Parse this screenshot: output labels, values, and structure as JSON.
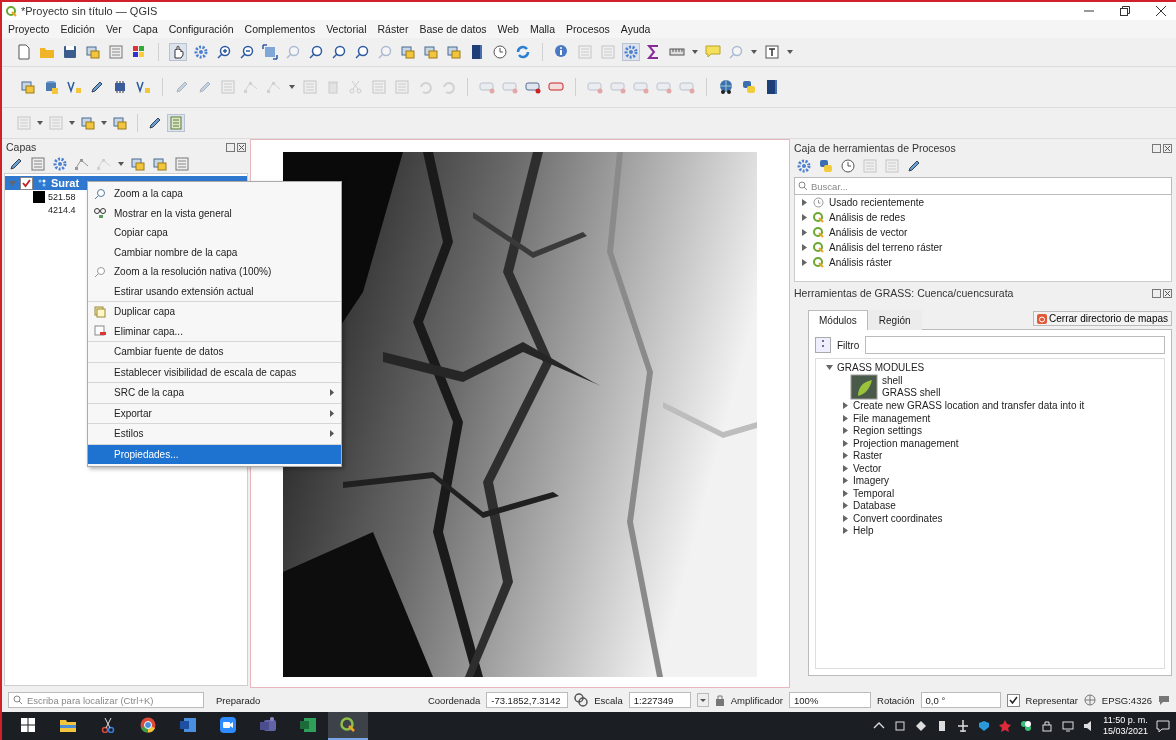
{
  "window": {
    "title": "*Proyecto sin título — QGIS"
  },
  "menu_bar": [
    "Proyecto",
    "Edición",
    "Ver",
    "Capa",
    "Configuración",
    "Complementos",
    "Vectorial",
    "Ráster",
    "Base de datos",
    "Web",
    "Malla",
    "Procesos",
    "Ayuda"
  ],
  "layers_panel": {
    "title": "Capas",
    "layers": [
      {
        "name": "Surat",
        "checked": true,
        "selected": true,
        "expanded": true,
        "legend": [
          "521.58",
          "4214.4"
        ]
      }
    ]
  },
  "context_menu": {
    "items": [
      {
        "label": "Zoom a la capa",
        "kind": "zoom",
        "submenu": false,
        "divider_above": false,
        "selected": false
      },
      {
        "label": "Mostrar en la vista general",
        "kind": "overview",
        "submenu": false,
        "divider_above": false,
        "selected": false
      },
      {
        "label": "Copiar capa",
        "kind": "plain",
        "submenu": false,
        "divider_above": false,
        "selected": false
      },
      {
        "label": "Cambiar nombre de la capa",
        "kind": "plain",
        "submenu": false,
        "divider_above": false,
        "selected": false
      },
      {
        "label": "Zoom a la resolución nativa (100%)",
        "kind": "native",
        "submenu": false,
        "divider_above": false,
        "selected": false
      },
      {
        "label": "Estirar usando extensión actual",
        "kind": "plain",
        "submenu": false,
        "divider_above": false,
        "selected": false
      },
      {
        "label": "Duplicar capa",
        "kind": "duplicate",
        "submenu": false,
        "divider_above": true,
        "selected": false
      },
      {
        "label": "Eliminar capa...",
        "kind": "remove",
        "submenu": false,
        "divider_above": false,
        "selected": false
      },
      {
        "label": "Cambiar fuente de datos",
        "kind": "plain",
        "submenu": false,
        "divider_above": true,
        "selected": false
      },
      {
        "label": "Establecer visibilidad de escala de capas",
        "kind": "plain",
        "submenu": false,
        "divider_above": true,
        "selected": false
      },
      {
        "label": "SRC de la capa",
        "kind": "plain",
        "submenu": true,
        "divider_above": true,
        "selected": false
      },
      {
        "label": "Exportar",
        "kind": "plain",
        "submenu": true,
        "divider_above": true,
        "selected": false
      },
      {
        "label": "Estilos",
        "kind": "plain",
        "submenu": true,
        "divider_above": true,
        "selected": false
      },
      {
        "label": "Propiedades...",
        "kind": "plain",
        "submenu": false,
        "divider_above": true,
        "selected": true
      }
    ]
  },
  "processing_toolbox": {
    "title": "Caja de herramientas de Procesos",
    "search": {
      "placeholder": "Buscar..."
    },
    "items": [
      {
        "label": "Usado recientemente",
        "kind": "recent",
        "expanded": false
      },
      {
        "label": "Análisis de redes",
        "kind": "provider",
        "expanded": false
      },
      {
        "label": "Análisis de vector",
        "kind": "provider",
        "expanded": false
      },
      {
        "label": "Análisis del terreno ráster",
        "kind": "provider",
        "expanded": false
      },
      {
        "label": "Análisis ráster",
        "kind": "provider",
        "expanded": false
      }
    ]
  },
  "grass_tools": {
    "title": "Herramientas de GRASS: Cuenca/cuencsurata",
    "tabs": [
      {
        "label": "Módulos",
        "selected": true
      },
      {
        "label": "Región",
        "selected": false
      }
    ],
    "close_button": "Cerrar directorio de mapas",
    "filter": {
      "label": "Filtro"
    },
    "tree": {
      "label": "GRASS MODULES",
      "expanded": true,
      "children": [
        {
          "kind": "module",
          "name": "shell",
          "description": "GRASS shell"
        },
        {
          "kind": "group",
          "label": "Create new GRASS location and transfer data into it",
          "expanded": false
        },
        {
          "kind": "group",
          "label": "File management",
          "expanded": false
        },
        {
          "kind": "group",
          "label": "Region settings",
          "expanded": false
        },
        {
          "kind": "group",
          "label": "Projection management",
          "expanded": false
        },
        {
          "kind": "group",
          "label": "Raster",
          "expanded": false
        },
        {
          "kind": "group",
          "label": "Vector",
          "expanded": false
        },
        {
          "kind": "group",
          "label": "Imagery",
          "expanded": false
        },
        {
          "kind": "group",
          "label": "Temporal",
          "expanded": false
        },
        {
          "kind": "group",
          "label": "Database",
          "expanded": false
        },
        {
          "kind": "group",
          "label": "Convert coordinates",
          "expanded": false
        },
        {
          "kind": "group",
          "label": "Help",
          "expanded": false
        }
      ]
    }
  },
  "status_bar": {
    "locator": {
      "placeholder": "Escriba para localizar (Ctrl+K)"
    },
    "message": "Preparado",
    "coordinate": {
      "label": "Coordenada",
      "value": "-73.1852,7.3142"
    },
    "scale": {
      "label": "Escala",
      "value": "1:227349"
    },
    "magnifier": {
      "label": "Amplificador",
      "value": "100%"
    },
    "rotation": {
      "label": "Rotación",
      "value": "0,0 °"
    },
    "render": {
      "label": "Representar",
      "checked": true
    },
    "crs": "EPSG:4326"
  },
  "taskbar": {
    "apps": [
      {
        "kind": "explorer",
        "selected": false
      },
      {
        "kind": "snip",
        "selected": false
      },
      {
        "kind": "browser",
        "selected": false
      },
      {
        "kind": "word",
        "selected": false
      },
      {
        "kind": "video",
        "selected": false
      },
      {
        "kind": "chat",
        "selected": false
      },
      {
        "kind": "sheet",
        "selected": false
      },
      {
        "kind": "gis",
        "selected": true
      }
    ],
    "time": "11:50 p. m.",
    "date": "15/03/2021"
  }
}
